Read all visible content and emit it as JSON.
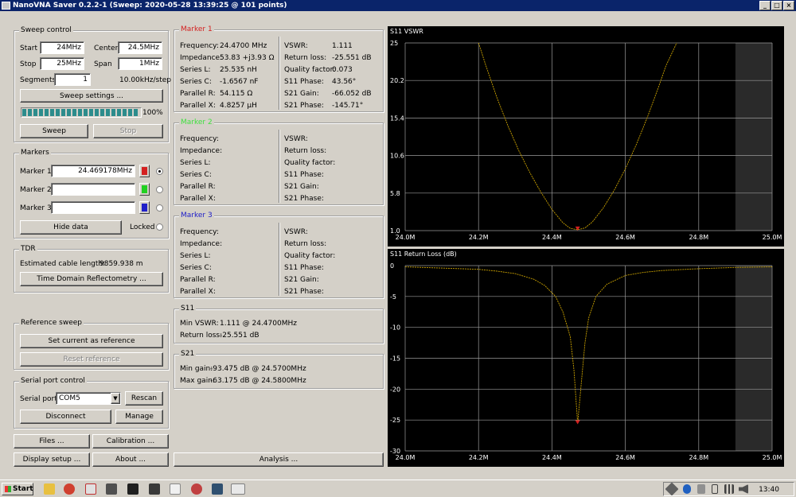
{
  "window": {
    "title": "NanoVNA Saver 0.2.2-1 (Sweep: 2020-05-28 13:39:25 @ 101 points)",
    "min": "_",
    "max": "□",
    "close": "×"
  },
  "sweep": {
    "title": "Sweep control",
    "start_label": "Start",
    "start": "24MHz",
    "center_label": "Center",
    "center": "24.5MHz",
    "stop_label": "Stop",
    "stop": "25MHz",
    "span_label": "Span",
    "span": "1MHz",
    "segments_label": "Segments",
    "segments": "1",
    "step": "10.00kHz/step",
    "settings": "Sweep settings ...",
    "progress": 100,
    "progress_text": "100%",
    "sweep_btn": "Sweep",
    "stop_btn": "Stop"
  },
  "markers": {
    "title": "Markers",
    "m1_label": "Marker 1",
    "m1": "24.469178MHz",
    "m1_color": "#d42020",
    "m2_label": "Marker 2",
    "m2": "",
    "m2_color": "#20d020",
    "m3_label": "Marker 3",
    "m3": "",
    "m3_color": "#2020c8",
    "hide": "Hide data",
    "locked": "Locked"
  },
  "tdr": {
    "title": "TDR",
    "cable_label": "Estimated cable length:",
    "cable": "9859.938 m",
    "btn": "Time Domain Reflectometry ..."
  },
  "reference": {
    "title": "Reference sweep",
    "set": "Set current as reference",
    "reset": "Reset reference"
  },
  "serial": {
    "title": "Serial port control",
    "port_label": "Serial port",
    "port": "COM5",
    "rescan": "Rescan",
    "disconnect": "Disconnect",
    "manage": "Manage"
  },
  "bottom": {
    "files": "Files ...",
    "calibration": "Calibration ...",
    "display": "Display setup ...",
    "about": "About ...",
    "analysis": "Analysis ..."
  },
  "marker1": {
    "title": "Marker 1",
    "color": "#d42020",
    "left_labels": [
      "Frequency:",
      "Impedance:",
      "Series L:",
      "Series C:",
      "Parallel R:",
      "Parallel X:"
    ],
    "left_values": [
      "24.4700 MHz",
      "53.83 +j3.93 Ω",
      "25.535 nH",
      "-1.6567 nF",
      "54.115 Ω",
      "4.8257 µH"
    ],
    "right_labels": [
      "VSWR:",
      "Return loss:",
      "Quality factor:",
      "S11 Phase:",
      "S21 Gain:",
      "S21 Phase:"
    ],
    "right_values": [
      "1.111",
      "-25.551 dB",
      "0.073",
      "43.56°",
      "-66.052 dB",
      "-145.71°"
    ]
  },
  "marker2": {
    "title": "Marker 2",
    "color": "#40e040",
    "left_labels": [
      "Frequency:",
      "Impedance:",
      "Series L:",
      "Series C:",
      "Parallel R:",
      "Parallel X:"
    ],
    "right_labels": [
      "VSWR:",
      "Return loss:",
      "Quality factor:",
      "S11 Phase:",
      "S21 Gain:",
      "S21 Phase:"
    ]
  },
  "marker3": {
    "title": "Marker 3",
    "color": "#2020c8",
    "left_labels": [
      "Frequency:",
      "Impedance:",
      "Series L:",
      "Series C:",
      "Parallel R:",
      "Parallel X:"
    ],
    "right_labels": [
      "VSWR:",
      "Return loss:",
      "Quality factor:",
      "S11 Phase:",
      "S21 Gain:",
      "S21 Phase:"
    ]
  },
  "s11": {
    "title": "S11",
    "min_vswr_label": "Min VSWR:",
    "min_vswr": "1.111 @ 24.4700MHz",
    "rl_label": "Return loss:",
    "rl": "-25.551 dB"
  },
  "s21": {
    "title": "S21",
    "min_label": "Min gain:",
    "min": "-93.475 dB @ 24.5700MHz",
    "max_label": "Max gain:",
    "max": "-63.175 dB @ 24.5800MHz"
  },
  "chart_data": [
    {
      "type": "line",
      "title": "S11 VSWR",
      "xlim": [
        24.0,
        25.0
      ],
      "ylim": [
        1.0,
        25
      ],
      "x_ticks": [
        "24.0M",
        "24.2M",
        "24.4M",
        "24.6M",
        "24.8M",
        "25.0M"
      ],
      "y_ticks": [
        "25",
        "20.2",
        "15.4",
        "10.6",
        "5.8",
        "1.0"
      ],
      "series": [
        {
          "color": "#c8a000",
          "x": [
            24.2,
            24.22,
            24.25,
            24.28,
            24.31,
            24.34,
            24.37,
            24.4,
            24.43,
            24.45,
            24.47,
            24.49,
            24.51,
            24.54,
            24.57,
            24.6,
            24.63,
            24.66,
            24.69,
            24.71,
            24.74
          ],
          "y": [
            25.0,
            22.1,
            18.0,
            14.4,
            11.2,
            8.4,
            5.9,
            3.7,
            2.0,
            1.3,
            1.11,
            1.35,
            2.1,
            3.9,
            6.2,
            8.9,
            12.0,
            15.5,
            19.3,
            22.0,
            25.0
          ]
        }
      ],
      "marker": {
        "x": 24.47,
        "y": 1.111,
        "color": "#d42020"
      }
    },
    {
      "type": "line",
      "title": "S11 Return Loss (dB)",
      "xlim": [
        24.0,
        25.0
      ],
      "ylim": [
        -30,
        0
      ],
      "x_ticks": [
        "24.0M",
        "24.2M",
        "24.4M",
        "24.6M",
        "24.8M",
        "25.0M"
      ],
      "y_ticks": [
        "0",
        "-5",
        "-10",
        "-15",
        "-20",
        "-25",
        "-30"
      ],
      "series": [
        {
          "color": "#c8a000",
          "x": [
            24.0,
            24.1,
            24.2,
            24.25,
            24.3,
            24.35,
            24.38,
            24.41,
            24.43,
            24.45,
            24.46,
            24.47,
            24.48,
            24.49,
            24.5,
            24.52,
            24.55,
            24.6,
            24.65,
            24.7,
            24.8,
            24.9,
            25.0
          ],
          "y": [
            -0.2,
            -0.4,
            -0.6,
            -0.9,
            -1.3,
            -2.2,
            -3.2,
            -5.0,
            -7.5,
            -11.5,
            -17.0,
            -25.55,
            -19.0,
            -12.5,
            -8.5,
            -5.0,
            -3.0,
            -1.6,
            -1.1,
            -0.8,
            -0.5,
            -0.3,
            -0.2
          ]
        }
      ],
      "marker": {
        "x": 24.47,
        "y": -25.551,
        "color": "#d42020"
      }
    }
  ],
  "taskbar": {
    "start": "Start",
    "time": "13:40"
  }
}
